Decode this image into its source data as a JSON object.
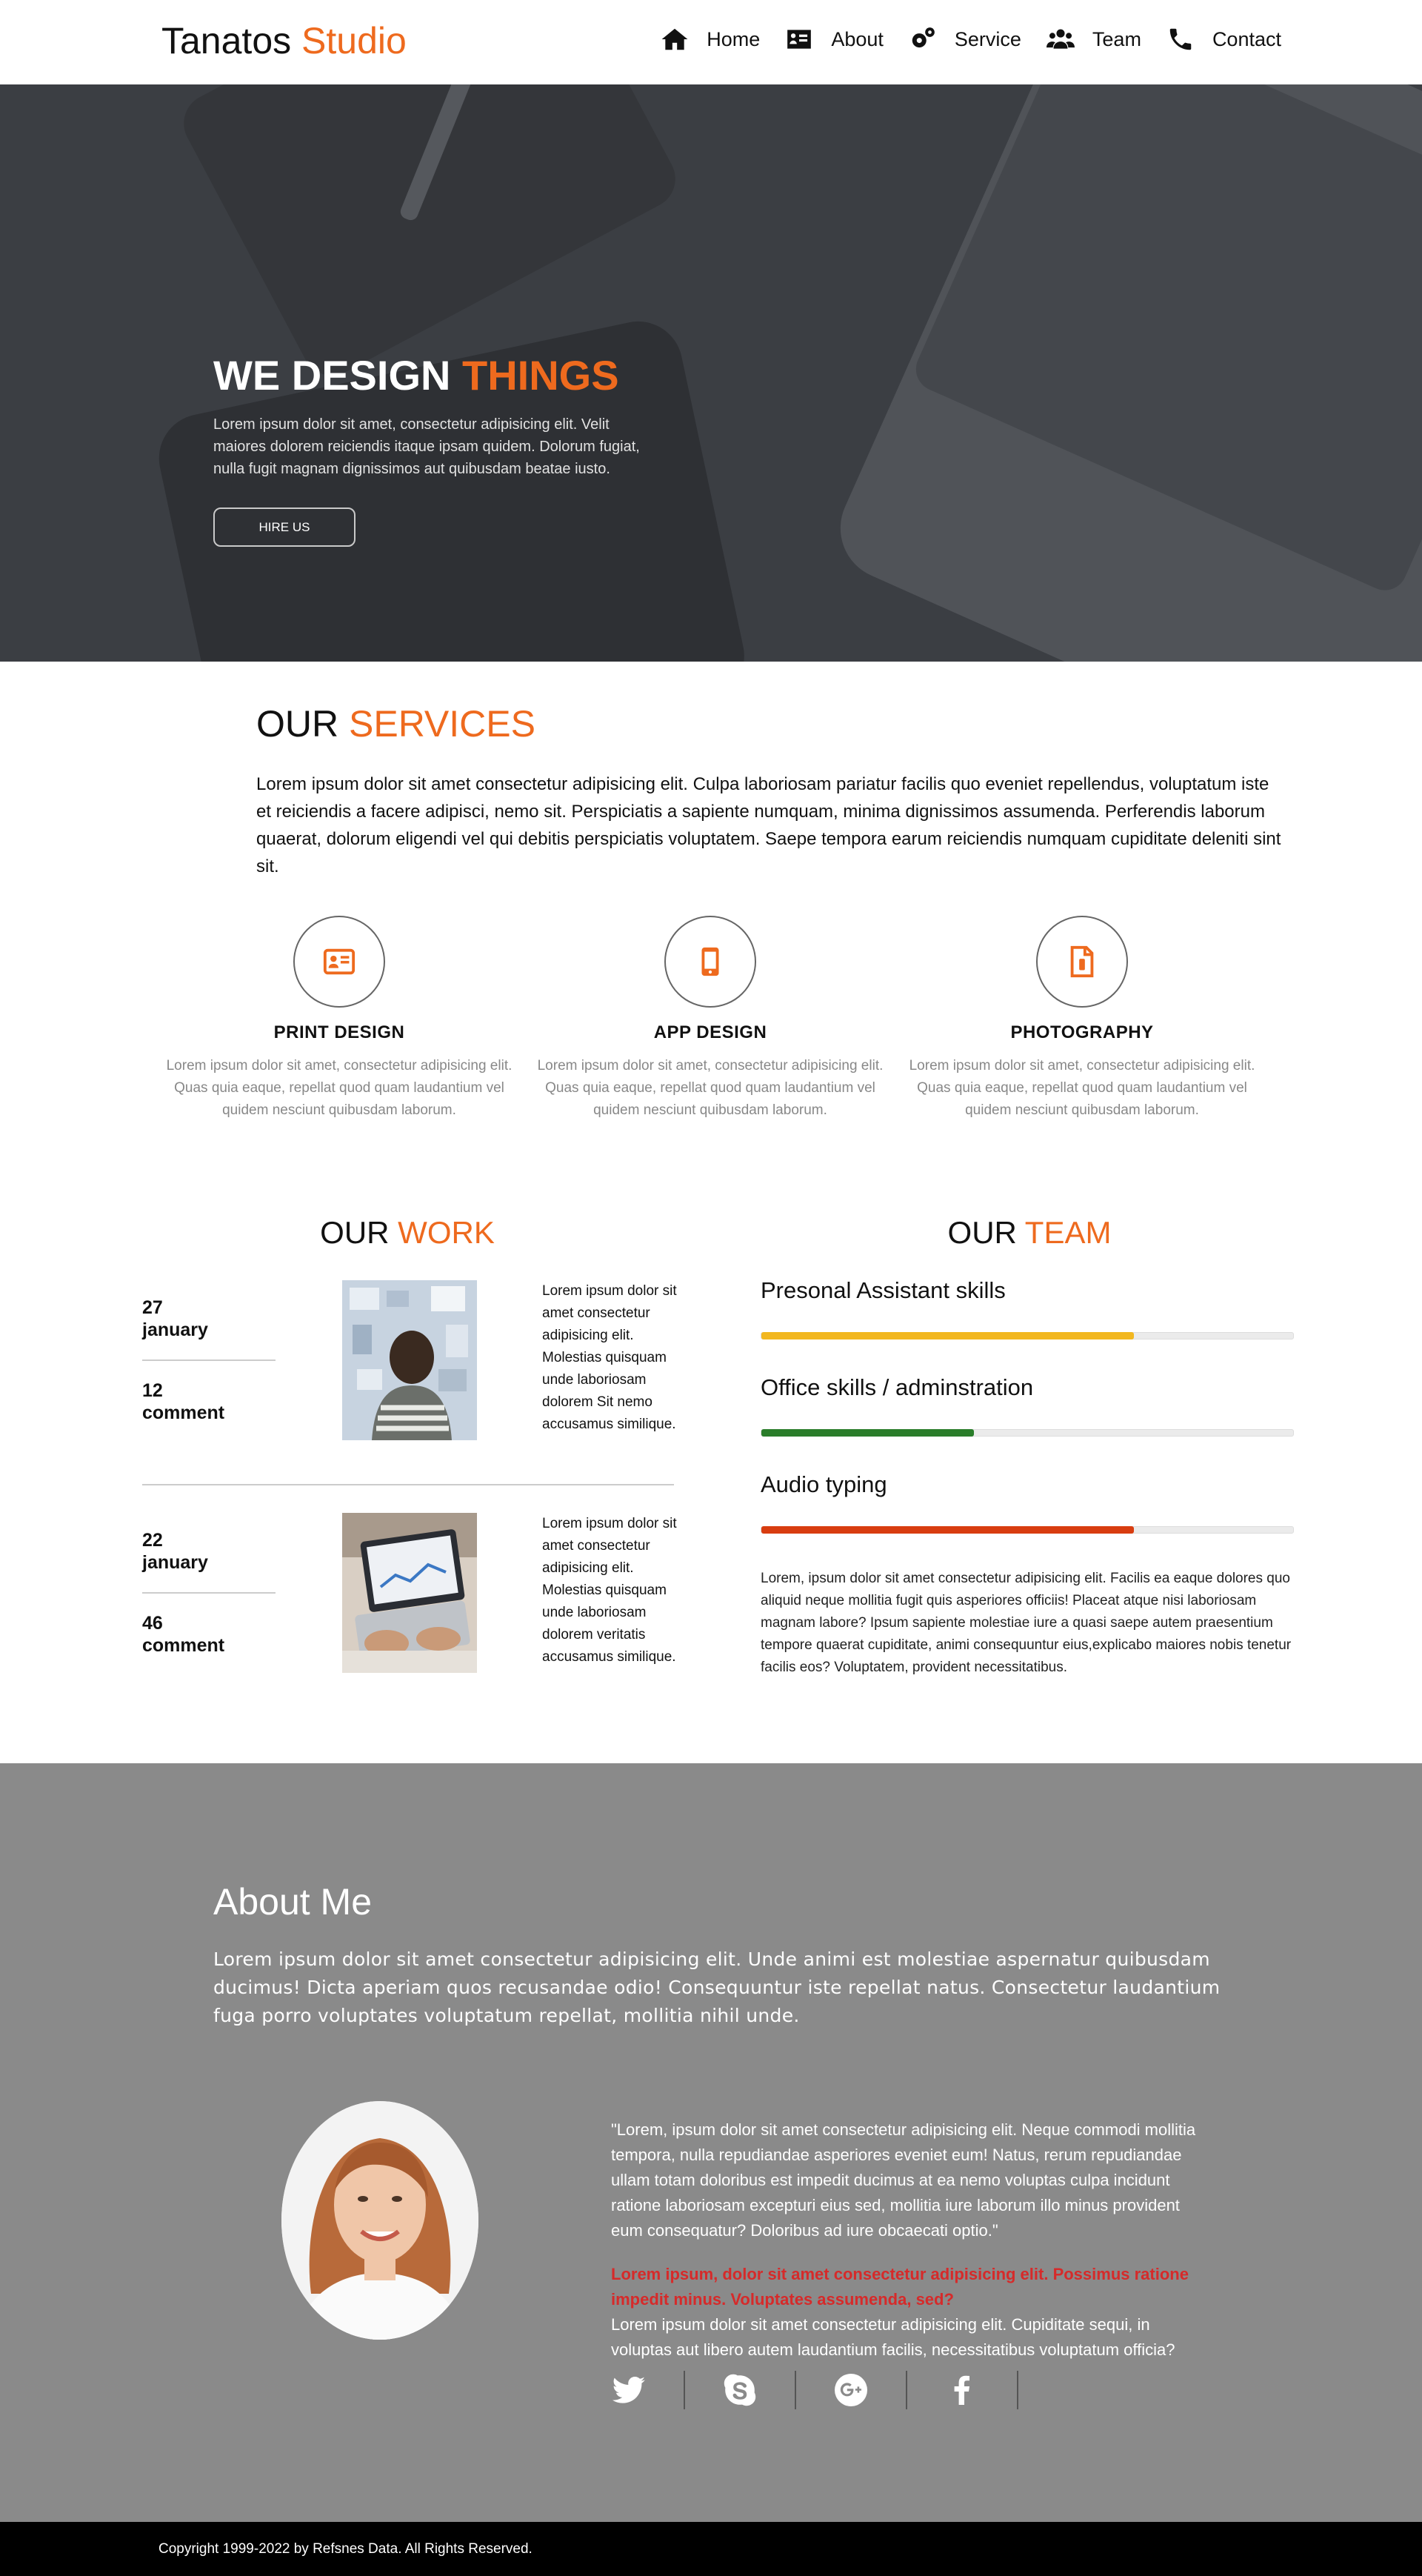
{
  "nav": {
    "brand_main": "Tanatos",
    "brand_accent": "Studio",
    "items": [
      {
        "label": "Home",
        "icon": "home-icon"
      },
      {
        "label": "About",
        "icon": "id-card-icon"
      },
      {
        "label": "Service",
        "icon": "gears-icon"
      },
      {
        "label": "Team",
        "icon": "users-icon"
      },
      {
        "label": "Contact",
        "icon": "phone-icon"
      }
    ]
  },
  "hero": {
    "title_main": "WE DESIGN",
    "title_accent": "THINGS",
    "text": "Lorem ipsum dolor sit amet, consectetur adipisicing elit. Velit maiores dolorem reiciendis itaque ipsam quidem. Dolorum fugiat, nulla fugit magnam dignissimos aut quibusdam beatae iusto.",
    "button_label": "HIRE US"
  },
  "services": {
    "title_main": "OUR",
    "title_accent": "SERVICES",
    "text": "Lorem ipsum dolor sit amet consectetur adipisicing elit. Culpa laboriosam pariatur facilis quo eveniet repellendus, voluptatum iste et reiciendis a facere adipisci, nemo sit. Perspiciatis a sapiente numquam, minima dignissimos assumenda. Perferendis laborum quaerat, dolorum eligendi vel qui debitis perspiciatis voluptatem. Saepe tempora earum reiciendis numquam cupiditate deleniti sint sit.",
    "items": [
      {
        "name": "PRINT DESIGN",
        "icon": "id-card-icon",
        "desc": "Lorem ipsum dolor sit amet, consectetur adipisicing elit. Quas quia eaque, repellat quod quam laudantium vel quidem nesciunt quibusdam laborum."
      },
      {
        "name": "APP DESIGN",
        "icon": "mobile-icon",
        "desc": "Lorem ipsum dolor sit amet, consectetur adipisicing elit. Quas quia eaque, repellat quod quam laudantium vel quidem nesciunt quibusdam laborum."
      },
      {
        "name": "PHOTOGRAPHY",
        "icon": "file-icon",
        "desc": "Lorem ipsum dolor sit amet, consectetur adipisicing elit. Quas quia eaque, repellat quod quam laudantium vel quidem nesciunt quibusdam laborum."
      }
    ]
  },
  "work": {
    "title_main": "OUR",
    "title_accent": "WORK",
    "entries": [
      {
        "day": "27",
        "month": "january",
        "count": "12",
        "count_label": "comment",
        "text": "Lorem ipsum dolor sit amet consectetur adipisicing elit. Molestias quisquam unde laboriosam dolorem Sit nemo accusamus similique."
      },
      {
        "day": "22",
        "month": "january",
        "count": "46",
        "count_label": "comment",
        "text": "Lorem ipsum dolor sit amet consectetur adipisicing elit. Molestias quisquam unde laboriosam dolorem veritatis accusamus similique."
      }
    ]
  },
  "team": {
    "title_main": "OUR",
    "title_accent": "TEAM",
    "skills": [
      {
        "label": "Presonal Assistant skills",
        "percent": 70,
        "color": "#f2b71f"
      },
      {
        "label": "Office skills / adminstration",
        "percent": 40,
        "color": "#2a7d2a"
      },
      {
        "label": "Audio typing",
        "percent": 70,
        "color": "#d83d10"
      }
    ],
    "text": "Lorem, ipsum dolor sit amet consectetur adipisicing elit. Facilis ea eaque dolores quo aliquid neque mollitia fugit quis asperiores officiis! Placeat atque nisi laboriosam magnam labore? Ipsum sapiente molestiae iure a quasi saepe autem praesentium tempore quaerat cupiditate, animi consequuntur eius,explicabo maiores nobis tenetur facilis eos? Voluptatem, provident necessitatibus."
  },
  "about": {
    "title": "About Me",
    "text": "Lorem ipsum dolor sit amet consectetur adipisicing elit. Unde animi est molestiae aspernatur quibusdam ducimus! Dicta aperiam quos recusandae odio! Consequuntur iste repellat natus. Consectetur laudantium fuga porro voluptates voluptatum repellat, mollitia nihil unde.",
    "quote": "\"Lorem, ipsum dolor sit amet consectetur adipisicing elit. Neque commodi mollitia tempora, nulla repudiandae asperiores eveniet eum! Natus, rerum repudiandae ullam totam doloribus est impedit ducimus at ea nemo voluptas culpa incidunt ratione laboriosam excepturi eius sed, mollitia iure laborum illo minus provident eum consequatur? Doloribus ad iure obcaecati optio.\"",
    "quote_red": "Lorem ipsum, dolor sit amet consectetur adipisicing elit. Possimus ratione impedit minus. Voluptates assumenda, sed?",
    "quote_tail": "Lorem ipsum dolor sit amet consectetur adipisicing elit. Cupiditate sequi, in voluptas aut libero autem laudantium facilis, necessitatibus voluptatum officia?",
    "socials": [
      "twitter-icon",
      "skype-icon",
      "google-plus-icon",
      "facebook-icon"
    ]
  },
  "footer": {
    "text": "Copyright 1999-2022 by Refsnes Data. All Rights Reserved."
  },
  "colors": {
    "accent": "#ee6a1e",
    "hero_bg": "#3b3e43",
    "about_bg": "#8a8a8a",
    "footer_bg": "#000000"
  }
}
